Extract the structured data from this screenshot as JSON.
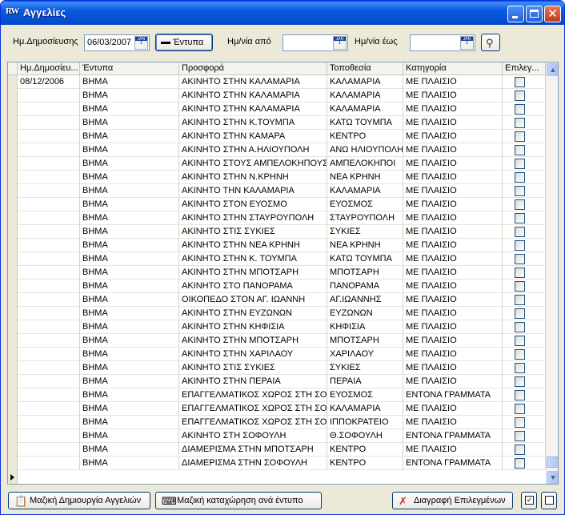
{
  "window": {
    "title": "Αγγελίες",
    "icon_text": "RW"
  },
  "filters": {
    "pub_date_label": "Ημ.Δημοσίευσης",
    "pub_date_value": "06/03/2007",
    "publications_button": "Έντυπα",
    "date_from_label": "Ημ/νία από",
    "date_from_value": "",
    "date_to_label": "Ημ/νία έως",
    "date_to_value": "",
    "calendar_icon_text": "JAN"
  },
  "table": {
    "columns": [
      "Ημ.Δημοσίευ...",
      "Έντυπα",
      "Προσφορά",
      "Τοποθεσία",
      "Κατηγορία",
      "Επιλεγ..."
    ],
    "rows": [
      [
        "08/12/2006",
        "ΒΗΜΑ",
        "ΑΚΙΝΗΤΟ ΣΤΗΝ ΚΑΛΑΜΑΡΙΑ",
        "ΚΑΛΑΜΑΡΙΑ",
        "ΜΕ ΠΛΑΙΣΙΟ"
      ],
      [
        "",
        "ΒΗΜΑ",
        "ΑΚΙΝΗΤΟ ΣΤΗΝ ΚΑΛΑΜΑΡΙΑ",
        "ΚΑΛΑΜΑΡΙΑ",
        "ΜΕ ΠΛΑΙΣΙΟ"
      ],
      [
        "",
        "ΒΗΜΑ",
        "ΑΚΙΝΗΤΟ ΣΤΗΝ ΚΑΛΑΜΑΡΙΑ",
        "ΚΑΛΑΜΑΡΙΑ",
        "ΜΕ ΠΛΑΙΣΙΟ"
      ],
      [
        "",
        "ΒΗΜΑ",
        "ΑΚΙΝΗΤΟ ΣΤΗΝ Κ.ΤΟΥΜΠΑ",
        "ΚΑΤΩ ΤΟΥΜΠΑ",
        "ΜΕ ΠΛΑΙΣΙΟ"
      ],
      [
        "",
        "ΒΗΜΑ",
        "ΑΚΙΝΗΤΟ ΣΤΗΝ ΚΑΜΑΡΑ",
        "ΚΕΝΤΡΟ",
        "ΜΕ ΠΛΑΙΣΙΟ"
      ],
      [
        "",
        "ΒΗΜΑ",
        "ΑΚΙΝΗΤΟ ΣΤΗΝ Α.ΗΛΙΟΥΠΟΛΗ",
        "ΑΝΩ ΗΛΙΟΥΠΟΛΗ",
        "ΜΕ ΠΛΑΙΣΙΟ"
      ],
      [
        "",
        "ΒΗΜΑ",
        "ΑΚΙΝΗΤΟ ΣΤΟΥΣ ΑΜΠΕΛΟΚΗΠΟΥΣ",
        "ΑΜΠΕΛΟΚΗΠΟΙ",
        "ΜΕ ΠΛΑΙΣΙΟ"
      ],
      [
        "",
        "ΒΗΜΑ",
        "ΑΚΙΝΗΤΟ ΣΤΗΝ Ν.ΚΡΗΝΗ",
        "ΝΕΑ ΚΡΗΝΗ",
        "ΜΕ ΠΛΑΙΣΙΟ"
      ],
      [
        "",
        "ΒΗΜΑ",
        "ΑΚΙΝΗΤΟ ΤΗΝ ΚΑΛΑΜΑΡΙΑ",
        "ΚΑΛΑΜΑΡΙΑ",
        "ΜΕ ΠΛΑΙΣΙΟ"
      ],
      [
        "",
        "ΒΗΜΑ",
        "ΑΚΙΝΗΤΟ ΣΤΟΝ ΕΥΟΣΜΟ",
        "ΕΥΟΣΜΟΣ",
        "ΜΕ ΠΛΑΙΣΙΟ"
      ],
      [
        "",
        "ΒΗΜΑ",
        "ΑΚΙΝΗΤΟ ΣΤΗΝ ΣΤΑΥΡΟΥΠΟΛΗ",
        "ΣΤΑΥΡΟΥΠΟΛΗ",
        "ΜΕ ΠΛΑΙΣΙΟ"
      ],
      [
        "",
        "ΒΗΜΑ",
        "ΑΚΙΝΗΤΟ ΣΤΙΣ ΣΥΚΙΕΣ",
        "ΣΥΚΙΕΣ",
        "ΜΕ ΠΛΑΙΣΙΟ"
      ],
      [
        "",
        "ΒΗΜΑ",
        "ΑΚΙΝΗΤΟ ΣΤΗΝ ΝΕΑ ΚΡΗΝΗ",
        "ΝΕΑ ΚΡΗΝΗ",
        "ΜΕ ΠΛΑΙΣΙΟ"
      ],
      [
        "",
        "ΒΗΜΑ",
        "ΑΚΙΝΗΤΟ ΣΤΗΝ Κ. ΤΟΥΜΠΑ",
        "ΚΑΤΩ ΤΟΥΜΠΑ",
        "ΜΕ ΠΛΑΙΣΙΟ"
      ],
      [
        "",
        "ΒΗΜΑ",
        "ΑΚΙΝΗΤΟ ΣΤΗΝ ΜΠΟΤΣΑΡΗ",
        "ΜΠΟΤΣΑΡΗ",
        "ΜΕ ΠΛΑΙΣΙΟ"
      ],
      [
        "",
        "ΒΗΜΑ",
        "ΑΚΙΝΗΤΟ ΣΤΟ ΠΑΝΟΡΑΜΑ",
        "ΠΑΝΟΡΑΜΑ",
        "ΜΕ ΠΛΑΙΣΙΟ"
      ],
      [
        "",
        "ΒΗΜΑ",
        "ΟΙΚΟΠΕΔΟ ΣΤΟΝ ΑΓ. ΙΩΑΝΝΗ",
        "ΑΓ.ΙΩΑΝΝΗΣ",
        "ΜΕ ΠΛΑΙΣΙΟ"
      ],
      [
        "",
        "ΒΗΜΑ",
        "ΑΚΙΝΗΤΟ ΣΤΗΝ ΕΥΖΩΝΩΝ",
        "ΕΥΖΩΝΩΝ",
        "ΜΕ ΠΛΑΙΣΙΟ"
      ],
      [
        "",
        "ΒΗΜΑ",
        "ΑΚΙΝΗΤΟ ΣΤΗΝ ΚΗΦΙΣΙΑ",
        "ΚΗΦΙΣΙΑ",
        "ΜΕ ΠΛΑΙΣΙΟ"
      ],
      [
        "",
        "ΒΗΜΑ",
        "ΑΚΙΝΗΤΟ ΣΤΗΝ ΜΠΟΤΣΑΡΗ",
        "ΜΠΟΤΣΑΡΗ",
        "ΜΕ ΠΛΑΙΣΙΟ"
      ],
      [
        "",
        "ΒΗΜΑ",
        "ΑΚΙΝΗΤΟ ΣΤΗΝ ΧΑΡΙΛΑΟΥ",
        "ΧΑΡΙΛΑΟΥ",
        "ΜΕ ΠΛΑΙΣΙΟ"
      ],
      [
        "",
        "ΒΗΜΑ",
        "ΑΚΙΝΗΤΟ ΣΤΙΣ ΣΥΚΙΕΣ",
        "ΣΥΚΙΕΣ",
        "ΜΕ ΠΛΑΙΣΙΟ"
      ],
      [
        "",
        "ΒΗΜΑ",
        "ΑΚΙΝΗΤΟ ΣΤΗΝ ΠΕΡΑΙΑ",
        "ΠΕΡΑΙΑ",
        "ΜΕ ΠΛΑΙΣΙΟ"
      ],
      [
        "",
        "ΒΗΜΑ",
        "ΕΠΑΓΓΕΛΜΑΤΙΚΟΣ ΧΩΡΟΣ ΣΤΗ ΣΟ...",
        "ΕΥΟΣΜΟΣ",
        "ΕΝΤΟΝΑ ΓΡΑΜΜΑΤΑ"
      ],
      [
        "",
        "ΒΗΜΑ",
        "ΕΠΑΓΓΕΛΜΑΤΙΚΟΣ ΧΩΡΟΣ ΣΤΗ ΣΟ...",
        "ΚΑΛΑΜΑΡΙΑ",
        "ΜΕ ΠΛΑΙΣΙΟ"
      ],
      [
        "",
        "ΒΗΜΑ",
        "ΕΠΑΓΓΕΛΜΑΤΙΚΟΣ ΧΩΡΟΣ ΣΤΗ ΣΟ...",
        "ΙΠΠΟΚΡΑΤΕΙΟ",
        "ΜΕ ΠΛΑΙΣΙΟ"
      ],
      [
        "",
        "ΒΗΜΑ",
        "ΑΚΙΝΗΤΟ ΣΤΗ ΣΟΦΟΥΛΗ",
        "Θ.ΣΟΦΟΥΛΗ",
        "ΕΝΤΟΝΑ ΓΡΑΜΜΑΤΑ"
      ],
      [
        "",
        "ΒΗΜΑ",
        "ΔΙΑΜΕΡΙΣΜΑ ΣΤΗΝ ΜΠΟΤΣΑΡΗ",
        "ΚΕΝΤΡΟ",
        "ΜΕ ΠΛΑΙΣΙΟ"
      ],
      [
        "",
        "ΒΗΜΑ",
        "ΔΙΑΜΕΡΙΣΜΑ ΣΤΗΝ ΣΟΦΟΥΛΗ",
        "ΚΕΝΤΡΟ",
        "ΕΝΤΟΝΑ ΓΡΑΜΜΑΤΑ"
      ]
    ],
    "selected": false
  },
  "actions": {
    "bulk_create": "Μαζική Δημιουργία Αγγελιών",
    "bulk_entry": "Μαζική καταχώρηση ανά έντυπο",
    "delete_selected": "Διαγραφή Επιλεγμένων"
  },
  "icons": {
    "minimize": "minimize-icon",
    "maximize": "maximize-icon",
    "close": "close-icon",
    "close_glyph": "✕",
    "filter": "funnel-icon",
    "delete": "x-icon",
    "delete_glyph": "✗",
    "scroll_up": "▲",
    "scroll_down": "▼",
    "check_all": "☑"
  },
  "colors": {
    "titlebar": "#0453d6",
    "close_button": "#c33a14",
    "delete_icon": "#c0392b"
  }
}
